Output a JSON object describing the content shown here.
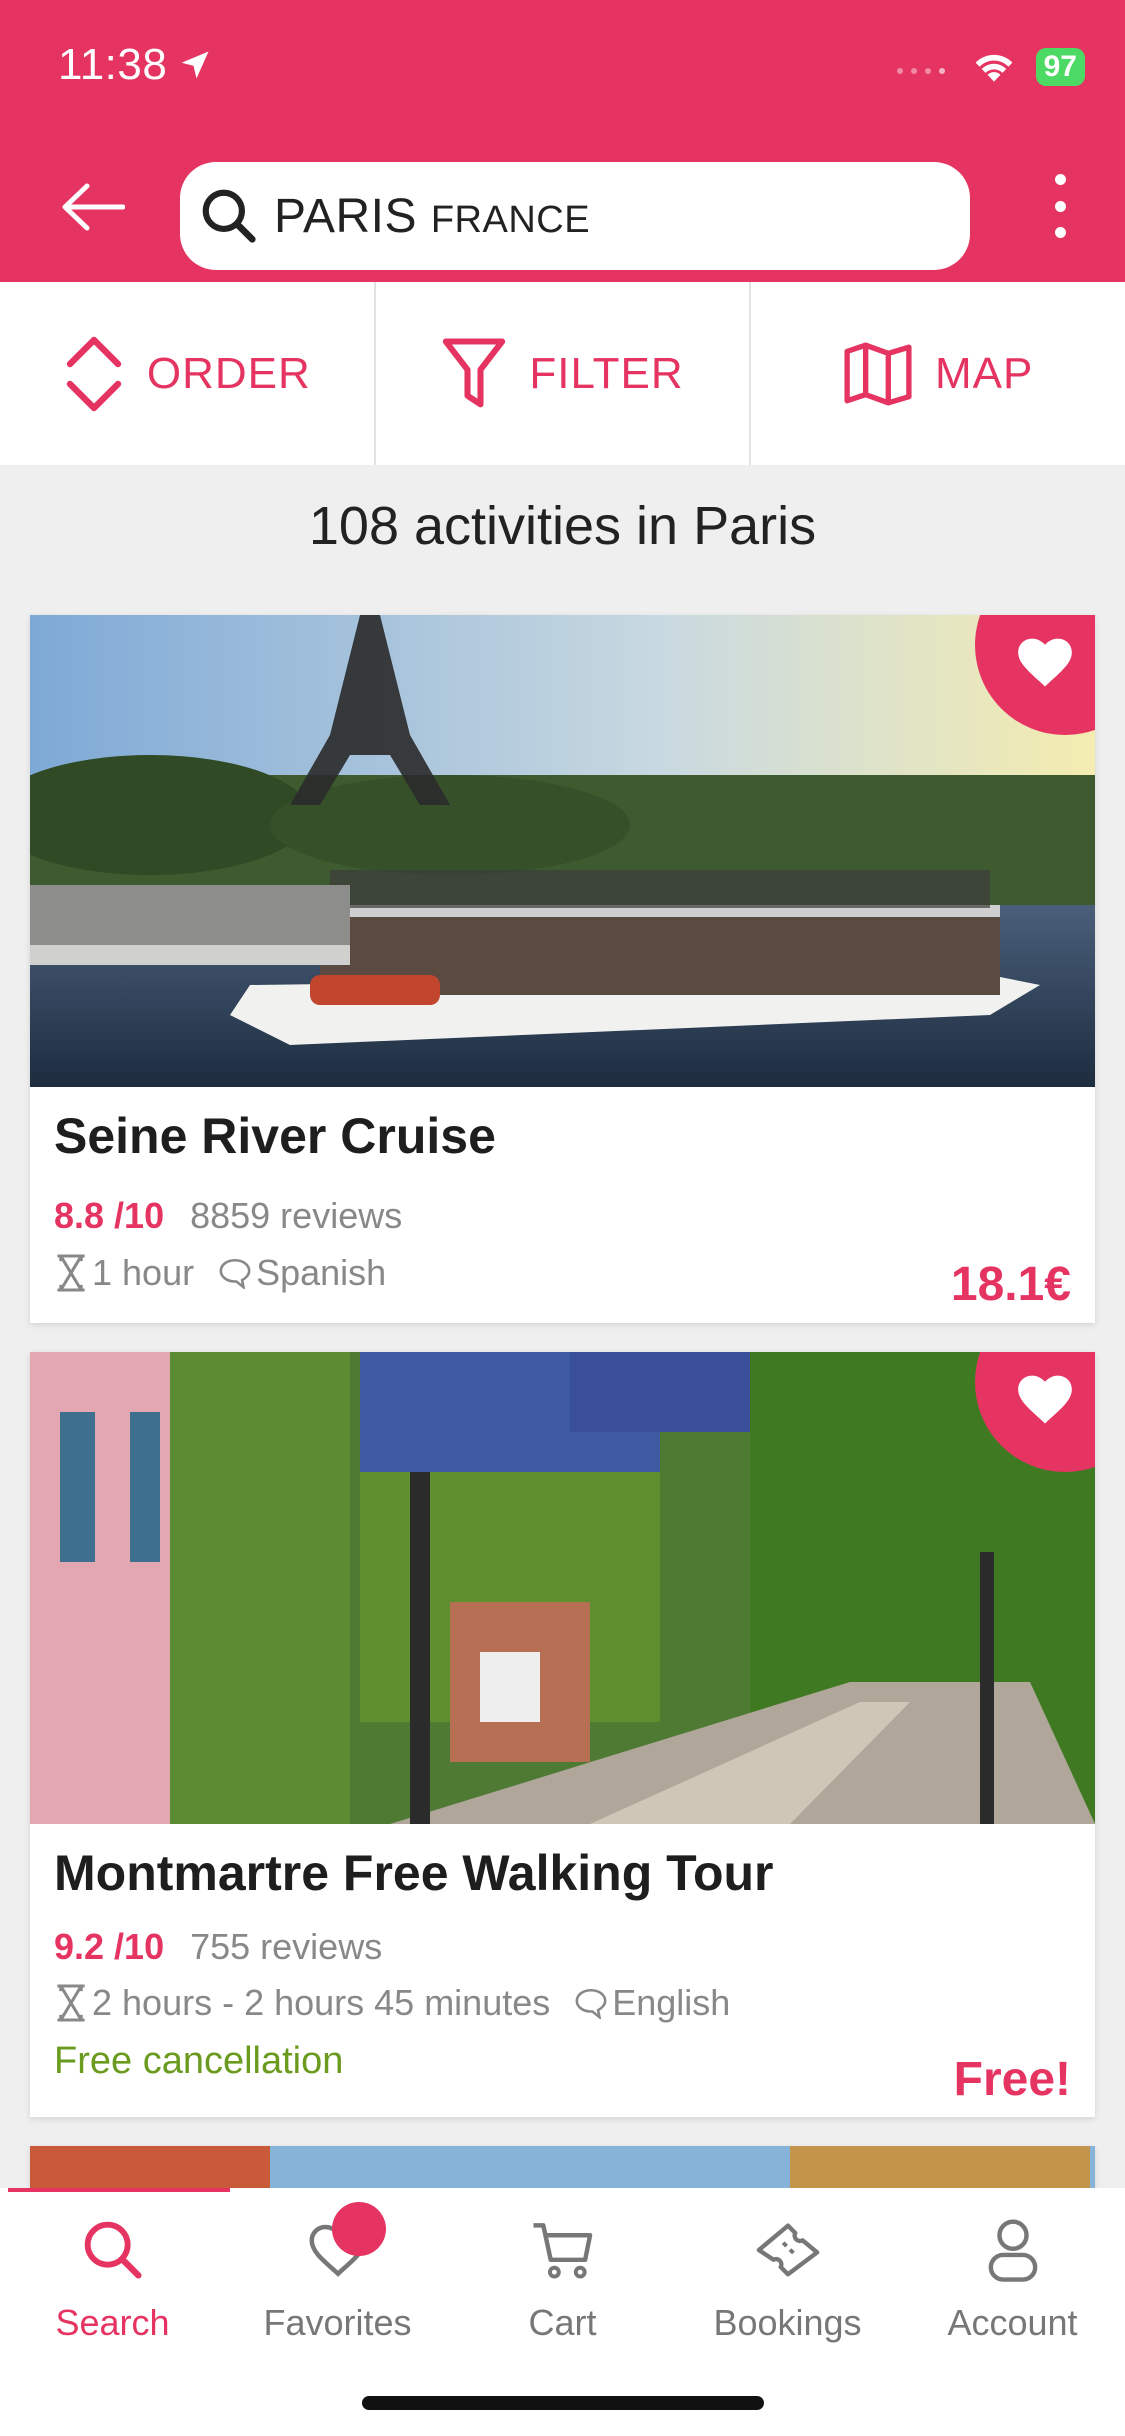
{
  "status_bar": {
    "time": "11:38",
    "battery": "97"
  },
  "search": {
    "city": "PARIS",
    "country": "FRANCE"
  },
  "toolbar": {
    "order": "ORDER",
    "filter": "FILTER",
    "map": "MAP"
  },
  "results_count": "108 activities in Paris",
  "cards": [
    {
      "title": "Seine River Cruise",
      "rating": "8.8 /10",
      "reviews": "8859 reviews",
      "duration": "1 hour",
      "language": "Spanish",
      "price": "18.1€",
      "favorite": true
    },
    {
      "title": "Montmartre Free Walking Tour",
      "rating": "9.2 /10",
      "reviews": "755 reviews",
      "duration": "2 hours -  2 hours 45 minutes",
      "language": "English",
      "cancellation": "Free cancellation",
      "price": "Free!",
      "favorite": true
    }
  ],
  "nav": {
    "items": [
      {
        "label": "Search",
        "icon": "search-icon",
        "active": true
      },
      {
        "label": "Favorites",
        "icon": "heart-icon",
        "badge": true
      },
      {
        "label": "Cart",
        "icon": "cart-icon"
      },
      {
        "label": "Bookings",
        "icon": "ticket-icon"
      },
      {
        "label": "Account",
        "icon": "person-icon"
      }
    ]
  },
  "colors": {
    "brand": "#e63462",
    "success": "#6a9b1f"
  }
}
